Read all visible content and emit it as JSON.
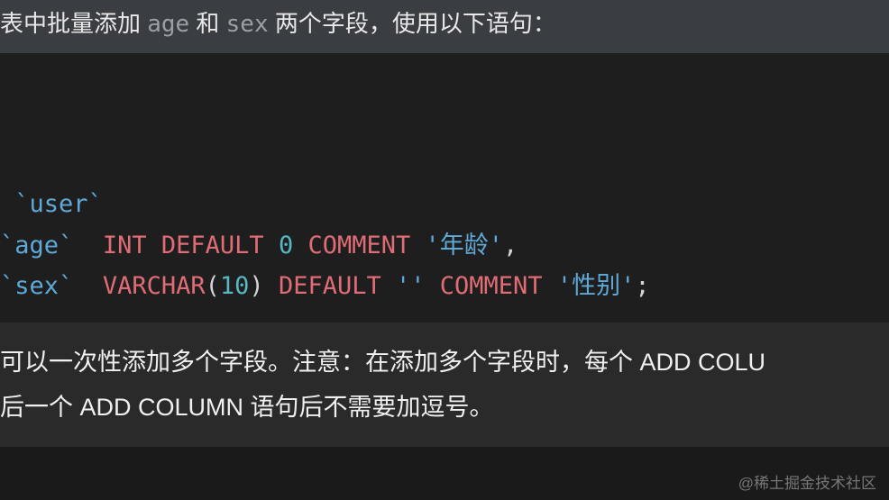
{
  "intro": {
    "pre": "表中批量添加 ",
    "code1": "age",
    "mid": " 和 ",
    "code2": "sex",
    "post": " 两个字段，使用以下语句："
  },
  "code": {
    "l1_tick1": " `",
    "l1_user": "user",
    "l1_tick2": "`",
    "l2_tick1": "`",
    "l2_age": "age",
    "l2_tick2": "`  ",
    "l2_int": "INT",
    "l2_sp1": " ",
    "l2_default": "DEFAULT",
    "l2_sp2": " ",
    "l2_zero": "0",
    "l2_sp3": " ",
    "l2_comment": "COMMENT",
    "l2_sp4": " ",
    "l2_str": "'年龄'",
    "l2_comma": ",",
    "l3_tick1": "`",
    "l3_sex": "sex",
    "l3_tick2": "`  ",
    "l3_varchar": "VARCHAR",
    "l3_paren1": "(",
    "l3_ten": "10",
    "l3_paren2": ")",
    "l3_sp1": " ",
    "l3_default": "DEFAULT",
    "l3_sp2": " ",
    "l3_empty": "''",
    "l3_sp3": " ",
    "l3_comment": "COMMENT",
    "l3_sp4": " ",
    "l3_str": "'性别'",
    "l3_semi": ";"
  },
  "explain": {
    "line1": "可以一次性添加多个字段。注意：在添加多个字段时，每个 ADD COLU",
    "line2": "后一个 ADD COLUMN 语句后不需要加逗号。"
  },
  "watermark": "@稀土掘金技术社区"
}
